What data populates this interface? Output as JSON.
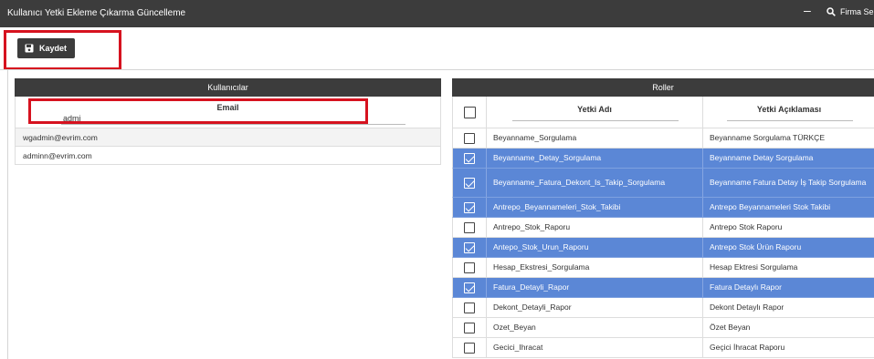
{
  "window": {
    "title": "Kullanıcı Yetki Ekleme Çıkarma Güncelleme",
    "minimize_glyph": "–",
    "search_icon": "search-icon",
    "search_label": "Firma Se"
  },
  "toolbar": {
    "save_label": "Kaydet",
    "save_icon": "save-icon"
  },
  "users_panel": {
    "title": "Kullanıcılar",
    "column_header": "Email",
    "filter_value": "admi",
    "rows": [
      "wgadmin@evrim.com",
      "adminn@evrim.com"
    ]
  },
  "roles_panel": {
    "title": "Roller",
    "col_name": "Yetki Adı",
    "col_desc": "Yetki Açıklaması",
    "rows": [
      {
        "name": "Beyanname_Sorgulama",
        "desc": "Beyanname Sorgulama TÜRKÇE",
        "selected": false
      },
      {
        "name": "Beyanname_Detay_Sorgulama",
        "desc": "Beyanname Detay Sorgulama",
        "selected": true
      },
      {
        "name": "Beyanname_Fatura_Dekont_Is_Takip_Sorgulama",
        "desc": "Beyanname Fatura Detay İş Takip Sorgulama",
        "selected": true
      },
      {
        "name": "Antrepo_Beyannameleri_Stok_Takibi",
        "desc": "Antrepo Beyannameleri Stok Takibi",
        "selected": true
      },
      {
        "name": "Antrepo_Stok_Raporu",
        "desc": "Antrepo Stok Raporu",
        "selected": false
      },
      {
        "name": "Antepo_Stok_Urun_Raporu",
        "desc": "Antrepo Stok Ürün Raporu",
        "selected": true
      },
      {
        "name": "Hesap_Ekstresi_Sorgulama",
        "desc": "Hesap Ektresi Sorgulama",
        "selected": false
      },
      {
        "name": "Fatura_Detayli_Rapor",
        "desc": "Fatura Detaylı Rapor",
        "selected": true
      },
      {
        "name": "Dekont_Detayli_Rapor",
        "desc": "Dekont Detaylı Rapor",
        "selected": false
      },
      {
        "name": "Ozet_Beyan",
        "desc": "Özet Beyan",
        "selected": false
      },
      {
        "name": "Gecici_Ihracat",
        "desc": "Geçici İhracat Raporu",
        "selected": false
      }
    ]
  },
  "colors": {
    "header_dark": "#3c3c3c",
    "selected_row": "#5b87d6",
    "highlight_box": "#d6121f"
  }
}
